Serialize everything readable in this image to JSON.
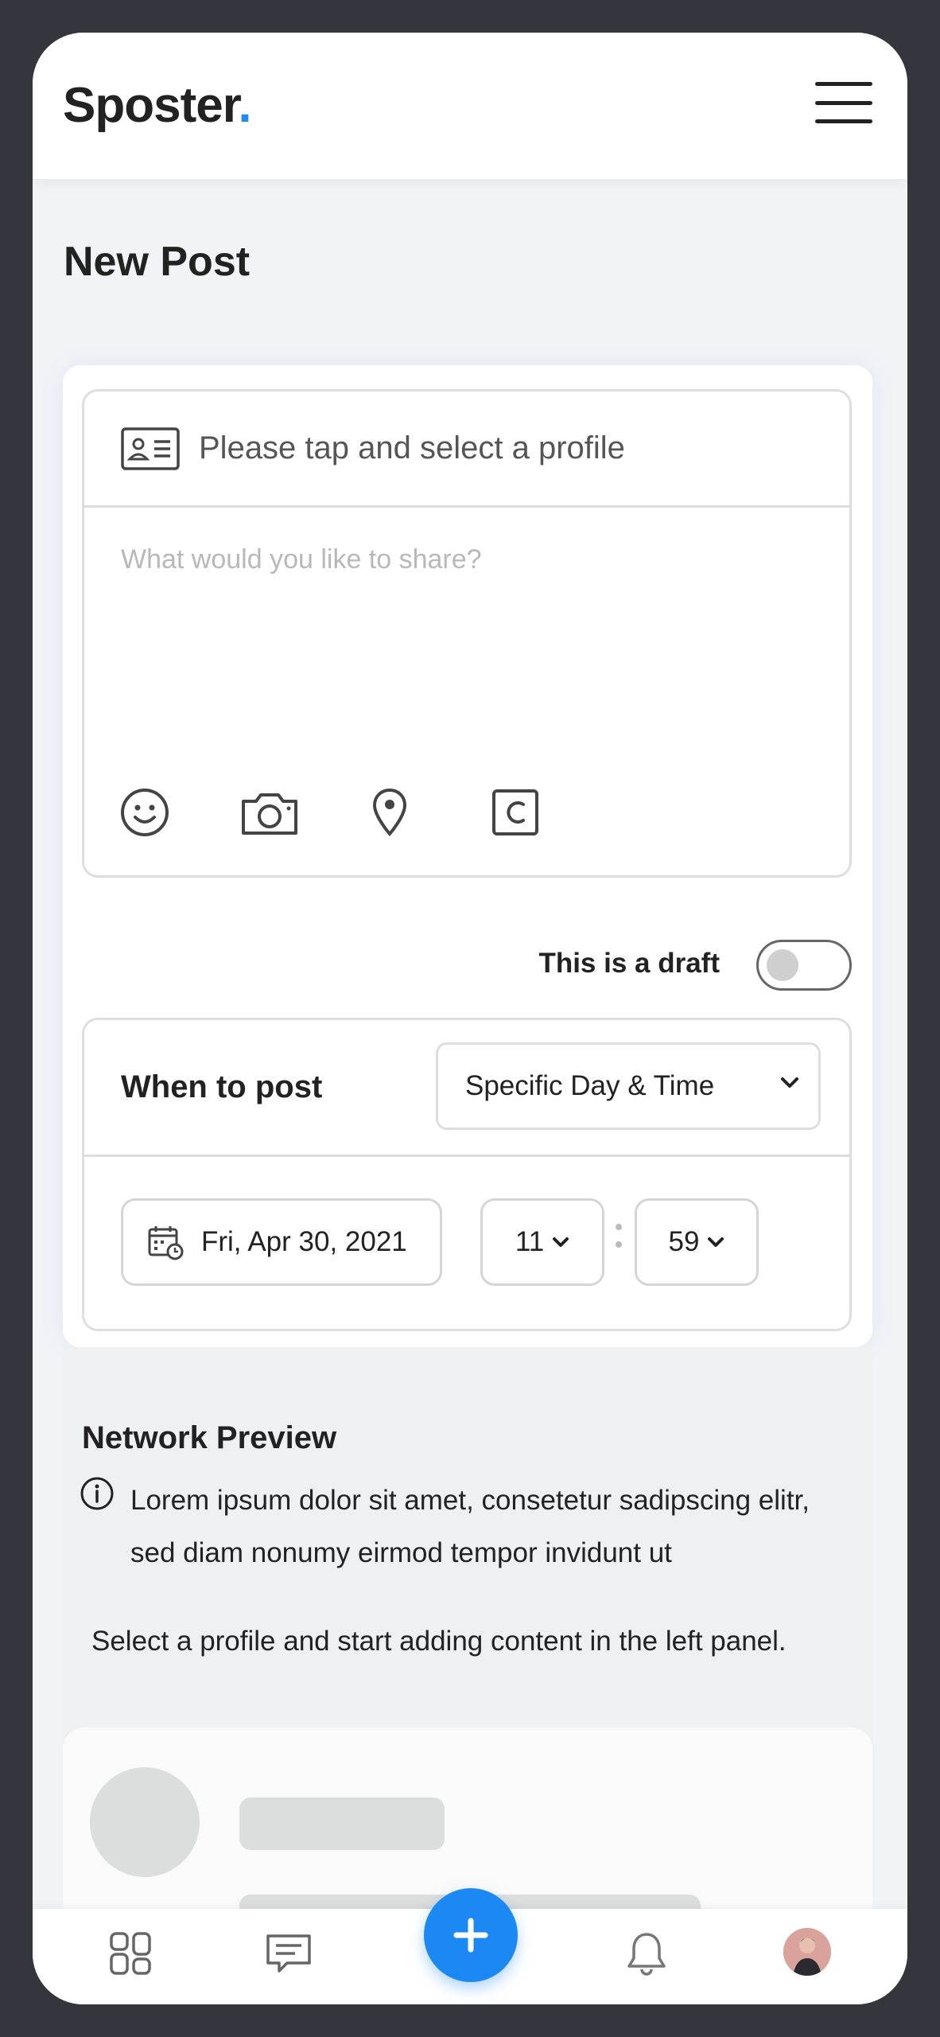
{
  "app": {
    "logo_text": "Sposter",
    "logo_dot": ".",
    "accent_color": "#1f8bf5"
  },
  "page": {
    "title": "New Post"
  },
  "compose": {
    "profile_prompt": "Please tap and select a profile",
    "placeholder": "What would you like to share?",
    "tools": [
      "smiley-icon",
      "camera-icon",
      "location-pin-icon",
      "copyright-icon"
    ]
  },
  "draft": {
    "label": "This is a draft",
    "enabled": false
  },
  "schedule": {
    "when_label": "When to post",
    "mode_selected": "Specific Day & Time",
    "date": "Fri, Apr 30, 2021",
    "hour": "11",
    "minute": "59"
  },
  "preview": {
    "title": "Network Preview",
    "description": "Lorem ipsum dolor sit amet, consetetur sadipscing elitr, sed diam nonumy eirmod tempor invidunt ut",
    "hint": "Select a profile and start adding content in the left panel."
  },
  "bottom_nav": {
    "items": [
      "dashboard-icon",
      "messages-icon",
      "add-post-button",
      "notifications-icon",
      "profile-avatar"
    ],
    "fab_color": "#1c88f4"
  }
}
